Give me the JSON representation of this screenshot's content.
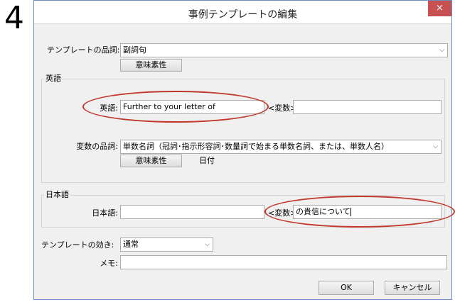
{
  "step_number": "4",
  "window": {
    "title": "事例テンプレートの編集",
    "close_symbol": "×"
  },
  "template_pos": {
    "label": "テンプレートの品詞:",
    "value": "副詞句",
    "attr_button": "意味素性"
  },
  "english_group": {
    "title": "英語",
    "label": "英語:",
    "value": "Further to your letter of",
    "variable_label": "<変数>",
    "variable_value": ""
  },
  "variable_pos": {
    "label": "変数の品詞:",
    "value": "単数名詞（冠詞･指示形容詞･数量詞で始まる単数名詞、または、単数人名）",
    "attr_button": "意味素性",
    "attr_value": "日付"
  },
  "japanese_group": {
    "title": "日本語",
    "label": "日本語:",
    "value": "",
    "variable_label": "<変数>",
    "variable_value": "の貴信について"
  },
  "effect": {
    "label": "テンプレートの効き:",
    "value": "通常"
  },
  "memo": {
    "label": "メモ:",
    "value": ""
  },
  "buttons": {
    "ok": "OK",
    "cancel": "キャンセル"
  },
  "highlight_color": "#c0392b",
  "icons": {
    "dropdown": "chevron-down-icon"
  }
}
